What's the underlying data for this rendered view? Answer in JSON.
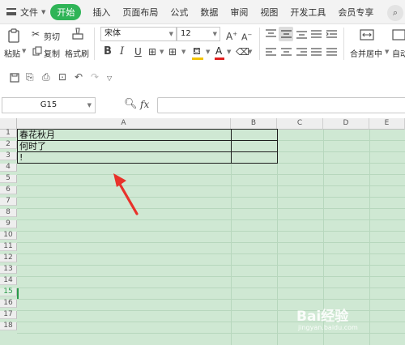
{
  "menu": {
    "file": "文件",
    "start": "开始",
    "items": [
      "插入",
      "页面布局",
      "公式",
      "数据",
      "审阅",
      "视图",
      "开发工具",
      "会员专享"
    ]
  },
  "ribbon": {
    "paste": "粘贴",
    "cut": "剪切",
    "copy": "复制",
    "format_painter": "格式刷",
    "font_name": "宋体",
    "font_size": "12",
    "merge_center": "合并居中",
    "auto_wrap": "自动"
  },
  "formula_bar": {
    "name_box": "G15",
    "fx": "fx",
    "formula": ""
  },
  "sheet": {
    "columns": [
      "A",
      "B",
      "C",
      "D",
      "E"
    ],
    "rows": [
      "1",
      "2",
      "3",
      "4",
      "5",
      "6",
      "7",
      "8",
      "9",
      "10",
      "11",
      "12",
      "13",
      "14",
      "15",
      "16",
      "17",
      "18"
    ],
    "selected_row": "15",
    "cells": {
      "a1": "春花秋月",
      "a2": "何时了",
      "a3": "!"
    }
  },
  "watermark": {
    "brand": "Bai经验",
    "url": "jingyan.baidu.com"
  },
  "colors": {
    "start_tab": "#2fb457",
    "grid_bg": "#cfe8d3",
    "arrow": "#e8322b"
  }
}
